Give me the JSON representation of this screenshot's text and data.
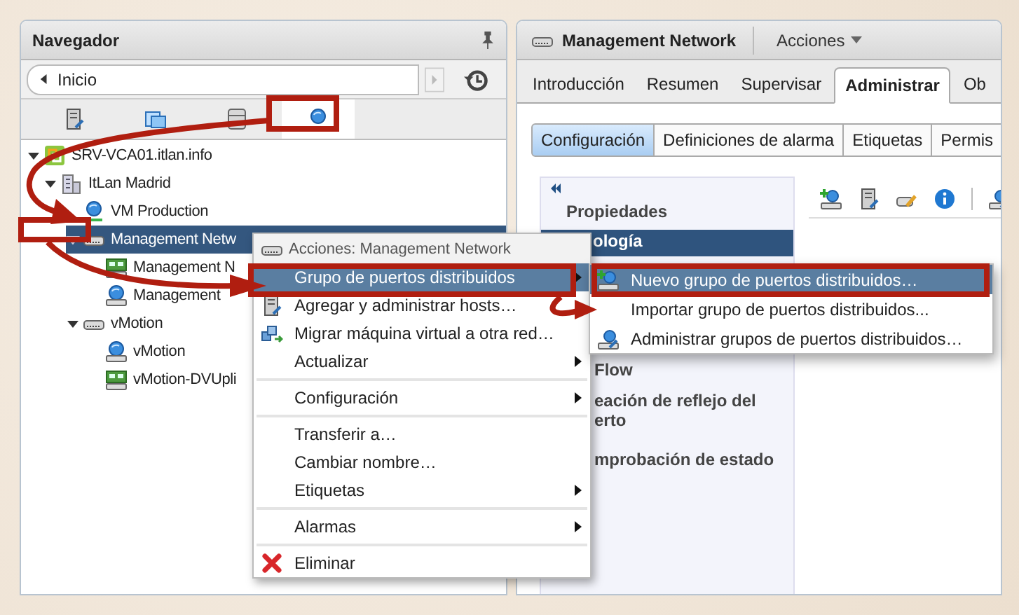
{
  "navigator": {
    "title": "Navegador",
    "breadcrumb": "Inicio",
    "object_tabs": [
      {
        "selected": false
      },
      {
        "selected": false
      },
      {
        "selected": false
      },
      {
        "selected": true
      }
    ]
  },
  "tree": [
    {
      "label": "SRV-VCA01.itlan.info",
      "kind": "vcenter",
      "expanded": true,
      "selected": false,
      "children": [
        {
          "label": "ItLan Madrid",
          "kind": "datacenter",
          "expanded": true,
          "selected": false,
          "children": [
            {
              "label": "VM Production",
              "kind": "network",
              "selected": false
            },
            {
              "label": "Management Netw",
              "kind": "switch",
              "expanded": true,
              "selected": true,
              "children": [
                {
                  "label": "Management N",
                  "kind": "uplinks",
                  "selected": false
                },
                {
                  "label": "Management",
                  "kind": "portgroup",
                  "selected": false
                }
              ]
            },
            {
              "label": "vMotion",
              "kind": "switch",
              "expanded": true,
              "selected": false,
              "children": [
                {
                  "label": "vMotion",
                  "kind": "portgroup",
                  "selected": false
                },
                {
                  "label": "vMotion-DVUpli",
                  "kind": "uplinks",
                  "selected": false
                }
              ]
            }
          ]
        }
      ]
    }
  ],
  "object": {
    "title": "Management Network",
    "actions": "Acciones",
    "tabs": [
      {
        "label": "Introducción",
        "selected": false
      },
      {
        "label": "Resumen",
        "selected": false
      },
      {
        "label": "Supervisar",
        "selected": false
      },
      {
        "label": "Administrar",
        "selected": true
      },
      {
        "label": "Ob",
        "selected": false
      }
    ],
    "subtabs": [
      {
        "label": "Configuración",
        "selected": true
      },
      {
        "label": "Definiciones de alarma",
        "selected": false
      },
      {
        "label": "Etiquetas",
        "selected": false
      },
      {
        "label": "Permis",
        "selected": false
      }
    ],
    "nav_items": [
      {
        "label": "Propiedades",
        "selected": false
      },
      {
        "label": "ología",
        "selected": true
      },
      {
        "label": "Flow",
        "selected": false
      },
      {
        "label": "eación de reflejo del erto",
        "selected": false
      },
      {
        "label": "mprobación de estado",
        "selected": false
      }
    ]
  },
  "context_menu": {
    "header": "Acciones: Management Network",
    "groups": [
      [
        {
          "label": "Grupo de puertos distribuidos",
          "kind": "submenu",
          "selected": true
        },
        {
          "label": "Agregar y administrar hosts…",
          "kind": "action",
          "selected": false
        },
        {
          "label": "Migrar máquina virtual a otra red…",
          "kind": "action",
          "selected": false
        },
        {
          "label": "Actualizar",
          "kind": "submenu",
          "selected": false
        }
      ],
      [
        {
          "label": "Configuración",
          "kind": "submenu",
          "selected": false
        }
      ],
      [
        {
          "label": "Transferir a…",
          "kind": "action",
          "selected": false
        },
        {
          "label": "Cambiar nombre…",
          "kind": "action",
          "selected": false
        },
        {
          "label": "Etiquetas",
          "kind": "submenu",
          "selected": false
        }
      ],
      [
        {
          "label": "Alarmas",
          "kind": "submenu",
          "selected": false
        }
      ],
      [
        {
          "label": "Eliminar",
          "kind": "action",
          "selected": false
        }
      ]
    ]
  },
  "submenu": {
    "items": [
      {
        "label": "Nuevo grupo de puertos distribuidos…",
        "selected": true
      },
      {
        "label": "Importar grupo de puertos distribuidos...",
        "selected": false
      },
      {
        "label": "Administrar grupos de puertos distribuidos…",
        "selected": false
      }
    ]
  }
}
